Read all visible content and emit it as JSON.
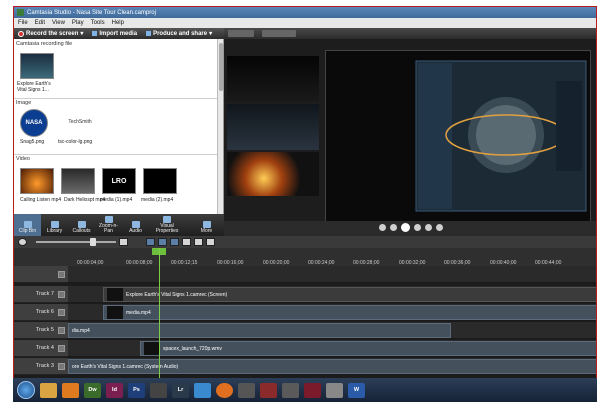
{
  "window": {
    "title": "Camtasia Studio - Nasa Site Tour Clean.camproj"
  },
  "menu": [
    "File",
    "Edit",
    "View",
    "Play",
    "Tools",
    "Help"
  ],
  "toolbar": {
    "record_label": "Record the screen",
    "import_label": "Import media",
    "produce_label": "Produce and share"
  },
  "clipbin": {
    "recording_section": "Camtasia recording file",
    "recording_caption": "Explore Earth's Vital Signs 1...",
    "image_section": "Image",
    "images": [
      {
        "caption": "Snag5.png",
        "thumb_text": "NASA"
      },
      {
        "caption": "tsc-color-lg.png",
        "thumb_text": "TechSmith"
      }
    ],
    "video_section": "Video",
    "videos": [
      {
        "caption": "Calling Listen mp4"
      },
      {
        "caption": "Dark Heliospt mp4"
      },
      {
        "caption": "media (1).mp4",
        "thumb_text": "LRO"
      },
      {
        "caption": "media (2).mp4"
      }
    ]
  },
  "tabs": [
    {
      "label": "Clip Bin",
      "active": true
    },
    {
      "label": "Library"
    },
    {
      "label": "Callouts"
    },
    {
      "label": "Zoom-n-Pan"
    },
    {
      "label": "Audio"
    },
    {
      "label": "Visual Properties"
    },
    {
      "label": "More"
    }
  ],
  "ruler": {
    "ticks": [
      "00:00:04;00",
      "00:00:08;00",
      "00:00:12;15",
      "00:00:16;00",
      "00:00:20;00",
      "00:00:24;00",
      "00:00:28;00",
      "00:00:32;00",
      "00:00:36;00",
      "00:00:40;00",
      "00:00:44;00"
    ]
  },
  "tracks": [
    {
      "label": "Track 7",
      "clip": "Explore Earth's Vital Signs 1.camrec (Screen)"
    },
    {
      "label": "Track 6",
      "clip": "media.mp4"
    },
    {
      "label": "Track 5",
      "clip": "dia.mp4"
    },
    {
      "label": "Track 4",
      "clip": "spacex_launch_720p.wmv"
    },
    {
      "label": "Track 3",
      "clip": "ore Earth's Vital Signs 1.camrec (System Audio)"
    }
  ],
  "taskbar": {
    "apps": [
      "Dw",
      "Id",
      "Ps",
      "Lr",
      "W"
    ]
  },
  "colors": {
    "accent": "#4e6f92",
    "playhead": "#7ccf45",
    "record": "#d32f2f"
  }
}
